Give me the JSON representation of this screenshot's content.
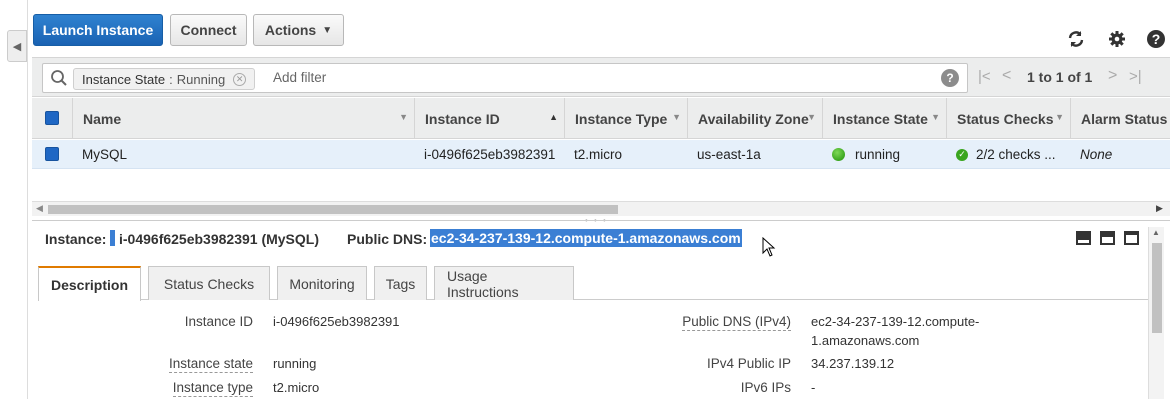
{
  "toolbar": {
    "launch_label": "Launch Instance",
    "connect_label": "Connect",
    "actions_label": "Actions"
  },
  "filter": {
    "token_key": "Instance State",
    "token_sep": ":",
    "token_value": "Running",
    "placeholder": "Add filter",
    "pagination": "1 to 1 of 1"
  },
  "grid": {
    "columns": [
      "Name",
      "Instance ID",
      "Instance Type",
      "Availability Zone",
      "Instance State",
      "Status Checks",
      "Alarm Status"
    ],
    "row": {
      "name": "MySQL",
      "instance_id": "i-0496f625eb3982391",
      "instance_type": "t2.micro",
      "zone": "us-east-1a",
      "state": "running",
      "checks": "2/2 checks ...",
      "alarm": "None"
    }
  },
  "detail": {
    "instance_label": "Instance:",
    "instance_value": "i-0496f625eb3982391 (MySQL)",
    "dns_label": "Public DNS:",
    "dns_value": "ec2-34-237-139-12.compute-1.amazonaws.com"
  },
  "tabs": [
    "Description",
    "Status Checks",
    "Monitoring",
    "Tags",
    "Usage Instructions"
  ],
  "description": {
    "left": [
      {
        "label": "Instance ID",
        "value": "i-0496f625eb3982391"
      },
      {
        "label": "Instance state",
        "value": "running"
      },
      {
        "label": "Instance type",
        "value": "t2.micro"
      }
    ],
    "right": [
      {
        "label": "Public DNS (IPv4)",
        "value_line1": "ec2-34-237-139-12.compute-",
        "value_line2": "1.amazonaws.com"
      },
      {
        "label": "IPv4 Public IP",
        "value": "34.237.139.12"
      },
      {
        "label": "IPv6 IPs",
        "value": "-"
      }
    ]
  },
  "colors": {
    "primary_button": "#1a62b3",
    "selection_highlight": "#3b7fd4",
    "running_green": "#3aa51f",
    "active_tab_accent": "#e07b00"
  }
}
